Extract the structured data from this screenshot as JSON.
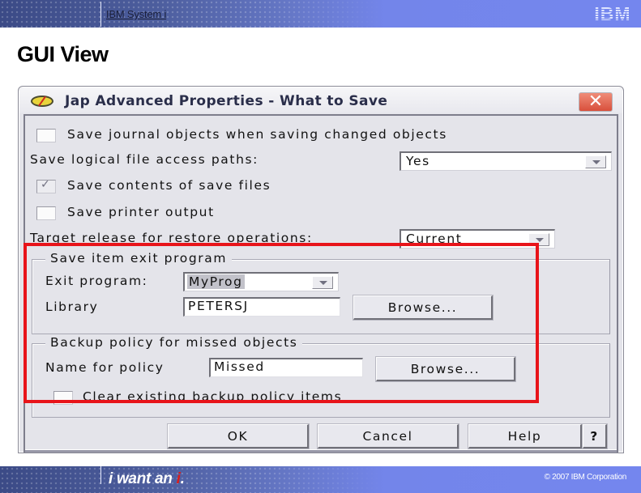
{
  "slide": {
    "header_title": "IBM System i",
    "logo": "IBM",
    "title": "GUI View",
    "footer_slogan_prefix": "i want an ",
    "footer_slogan_accent": "i",
    "footer_slogan_suffix": ".",
    "copyright": "© 2007 IBM Corporation",
    "annotation_color": "#e8141a"
  },
  "dialog": {
    "title": "Jap  Advanced Properties - What to Save",
    "app_icon": "palette-icon",
    "close_icon": "close-icon",
    "save_journal": {
      "label": "Save journal objects when saving changed objects",
      "checked": false
    },
    "logical_paths": {
      "label": "Save logical file access paths:",
      "value": "Yes"
    },
    "save_contents": {
      "label": "Save contents of save files",
      "checked": true
    },
    "save_printer": {
      "label": "Save printer output",
      "checked": false
    },
    "target_release": {
      "label": "Target release for restore operations:",
      "value": "Current"
    },
    "exit_group": {
      "legend": "Save item exit program",
      "exit_program_label": "Exit program:",
      "exit_program_value": "MyProg",
      "library_label": "Library",
      "library_value": "PETERSJ",
      "browse_label": "Browse..."
    },
    "backup_group": {
      "legend": "Backup policy for missed objects",
      "name_label": "Name for policy",
      "name_value": "Missed",
      "browse_label": "Browse...",
      "clear_label": "Clear existing backup policy items",
      "clear_checked": false
    },
    "buttons": {
      "ok": "OK",
      "cancel": "Cancel",
      "help": "Help",
      "whats_this": "?"
    }
  }
}
